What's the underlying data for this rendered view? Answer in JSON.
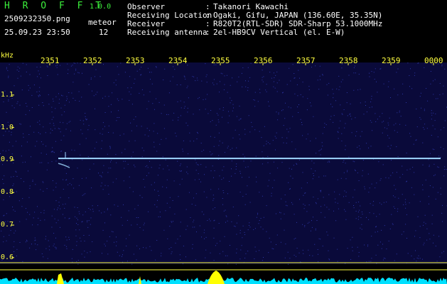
{
  "header": {
    "app_title": "H R O F F T",
    "app_version": "1.0.0",
    "file_name": "2509232350.png",
    "date_time": "25.09.23 23:50",
    "meteor_label": "meteor",
    "meteor_count": "12"
  },
  "info": [
    {
      "label": "Observer",
      "value": "Takanori Kawachi"
    },
    {
      "label": "Receiving Location",
      "value": "Ogaki, Gifu, JAPAN (136.60E, 35.35N)"
    },
    {
      "label": "Receiver",
      "value": "R820T2(RTL-SDR) SDR-Sharp 53.1000MHz"
    },
    {
      "label": "Receiving antenna",
      "value": "2el-HB9CV Vertical (el. E-W)"
    }
  ],
  "colon": ":",
  "chart_data": {
    "type": "heatmap",
    "ylabel": "kHz",
    "x_ticks": [
      "2351",
      "2352",
      "2353",
      "2354",
      "2355",
      "2356",
      "2357",
      "2358",
      "2359",
      "0000"
    ],
    "y_ticks": [
      "1.1",
      "1.0",
      "0.9",
      "0.8",
      "0.7",
      "0.6"
    ],
    "ylim": [
      0.58,
      1.2
    ],
    "carrier_khz": 0.905,
    "colors": {
      "background": "#0a0a3a",
      "noise": "#4a5cff",
      "carrier": "#a0d8ff",
      "label": "#ffff40",
      "level": "#00e0ff",
      "peak": "#ffff00"
    }
  }
}
